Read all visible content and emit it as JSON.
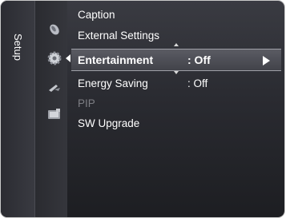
{
  "sidebar": {
    "tab_label": "Setup",
    "icons": [
      {
        "name": "picture-icon"
      },
      {
        "name": "setup-gear-icon"
      },
      {
        "name": "input-icon"
      },
      {
        "name": "application-icon"
      }
    ]
  },
  "menu": {
    "items": [
      {
        "label": "Caption",
        "value": "",
        "state": "normal"
      },
      {
        "label": "External Settings",
        "value": "",
        "state": "normal"
      },
      {
        "label": "Entertainment",
        "value": ": Off",
        "state": "selected"
      },
      {
        "label": "Energy Saving",
        "value": ": Off",
        "state": "normal"
      },
      {
        "label": "PIP",
        "value": "",
        "state": "disabled"
      },
      {
        "label": "SW Upgrade",
        "value": "",
        "state": "normal"
      }
    ]
  },
  "colors": {
    "background": "#2a2b31",
    "highlight": "#52535b",
    "text": "#ffffff",
    "disabled_text": "#7d7e84"
  }
}
